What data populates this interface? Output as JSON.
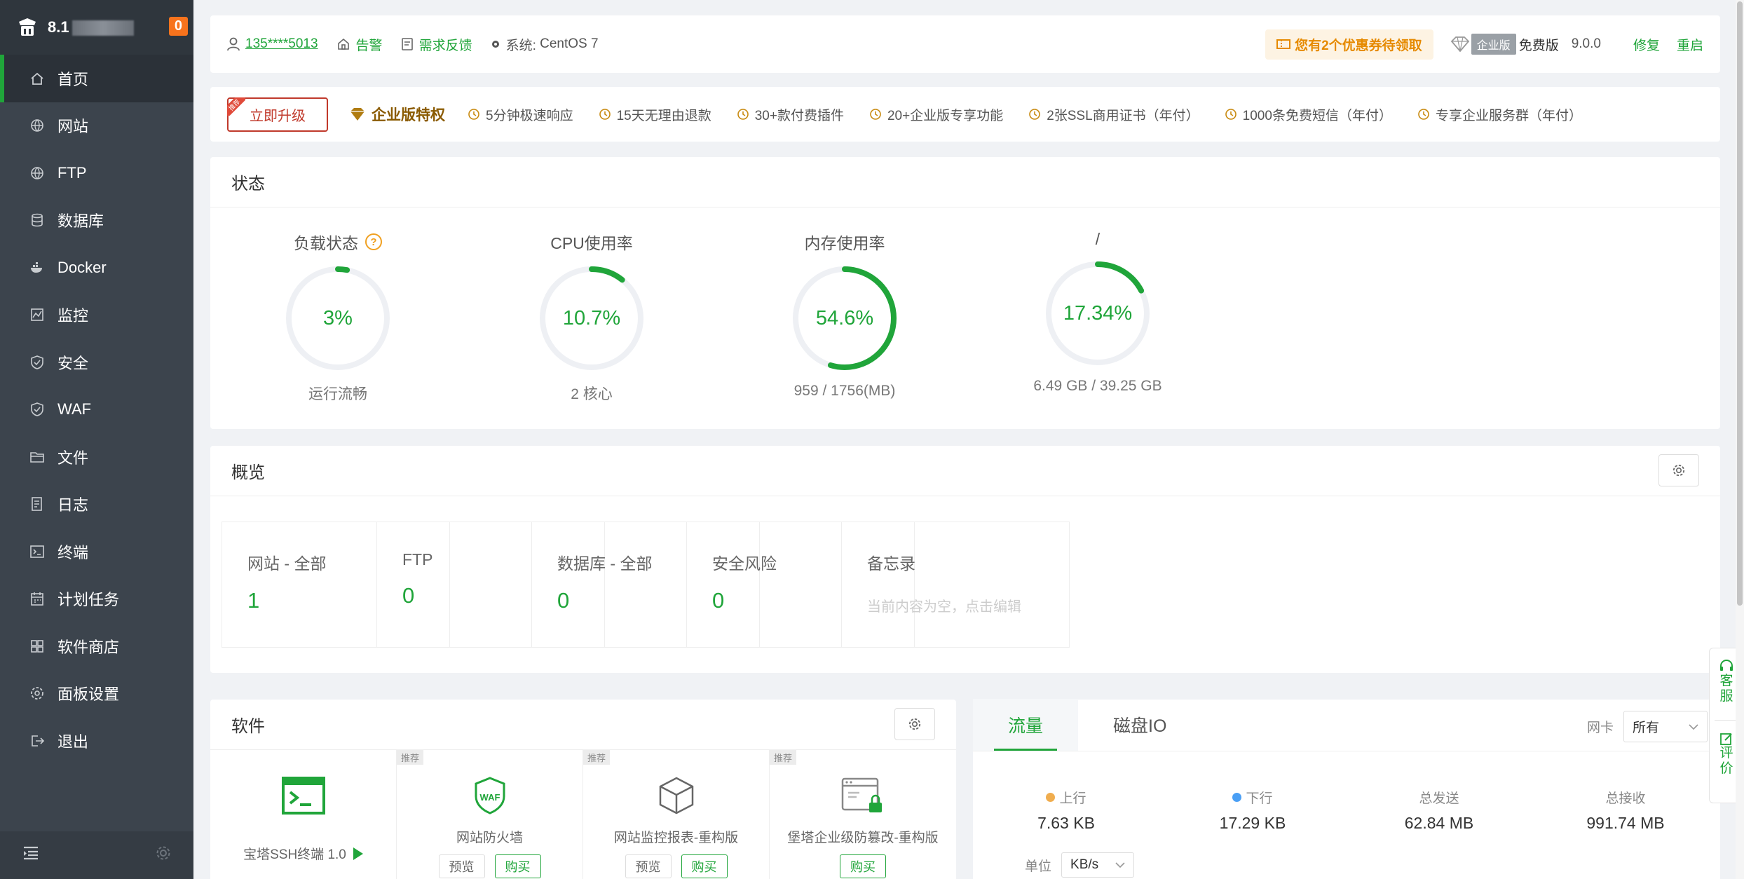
{
  "sidebar": {
    "ip_prefix": "8.1",
    "badge": "0",
    "items": [
      {
        "label": "首页",
        "icon": "home-icon"
      },
      {
        "label": "网站",
        "icon": "globe-icon"
      },
      {
        "label": "FTP",
        "icon": "globe-icon"
      },
      {
        "label": "数据库",
        "icon": "database-icon"
      },
      {
        "label": "Docker",
        "icon": "docker-icon"
      },
      {
        "label": "监控",
        "icon": "monitor-icon"
      },
      {
        "label": "安全",
        "icon": "shield-icon"
      },
      {
        "label": "WAF",
        "icon": "shield-icon"
      },
      {
        "label": "文件",
        "icon": "folder-icon"
      },
      {
        "label": "日志",
        "icon": "log-icon"
      },
      {
        "label": "终端",
        "icon": "terminal-icon"
      },
      {
        "label": "计划任务",
        "icon": "calendar-icon"
      },
      {
        "label": "软件商店",
        "icon": "grid-icon"
      },
      {
        "label": "面板设置",
        "icon": "gear-icon"
      },
      {
        "label": "退出",
        "icon": "logout-icon"
      }
    ]
  },
  "topbar": {
    "user": "135****5013",
    "alarm": "告警",
    "feedback": "需求反馈",
    "system_label": "系统:",
    "system_value": "CentOS 7",
    "coupon": "您有2个优惠券待领取",
    "enterprise_tag": "企业版",
    "edition": "免费版",
    "version": "9.0.0",
    "repair": "修复",
    "restart": "重启"
  },
  "upgrade": {
    "ribbon": "推荐",
    "button": "立即升级",
    "enterprise": "企业版特权",
    "features": [
      "5分钟极速响应",
      "15天无理由退款",
      "30+款付费插件",
      "20+企业版专享功能",
      "2张SSL商用证书（年付）",
      "1000条免费短信（年付）",
      "专享企业服务群（年付）"
    ]
  },
  "status": {
    "title": "状态",
    "gauges": [
      {
        "title": "负载状态",
        "value": "3%",
        "percent": 3,
        "sub": "运行流畅",
        "help": "?"
      },
      {
        "title": "CPU使用率",
        "value": "10.7%",
        "percent": 10.7,
        "sub": "2 核心"
      },
      {
        "title": "内存使用率",
        "value": "54.6%",
        "percent": 54.6,
        "sub": "959 / 1756(MB)"
      },
      {
        "title": "/",
        "value": "17.34%",
        "percent": 17.34,
        "sub": "6.49 GB / 39.25 GB"
      }
    ],
    "colors": {
      "ring": "#20a53a",
      "track": "#eef0f4"
    }
  },
  "overview": {
    "title": "概览",
    "boxes": [
      {
        "label": "网站 - 全部",
        "value": "1"
      },
      {
        "label": "FTP",
        "value": "0"
      },
      {
        "label": "数据库 - 全部",
        "value": "0"
      },
      {
        "label": "安全风险",
        "value": "0"
      },
      {
        "label": "备忘录",
        "note": "当前内容为空，点击编辑"
      }
    ]
  },
  "software": {
    "title": "软件",
    "items": [
      {
        "name": "宝塔SSH终端 1.0",
        "tag": ""
      },
      {
        "name": "网站防火墙",
        "tag": "推荐",
        "preview": "预览",
        "buy": "购买"
      },
      {
        "name": "网站监控报表-重构版",
        "tag": "推荐",
        "preview": "预览",
        "buy": "购买"
      },
      {
        "name": "堡塔企业级防篡改-重构版",
        "tag": "推荐",
        "buy": "购买"
      }
    ]
  },
  "traffic": {
    "tabs": [
      "流量",
      "磁盘IO"
    ],
    "nic_label": "网卡",
    "nic_value": "所有",
    "stats": [
      {
        "label": "上行",
        "value": "7.63 KB",
        "color": "#f0ad4e"
      },
      {
        "label": "下行",
        "value": "17.29 KB",
        "color": "#4a9ff5"
      },
      {
        "label": "总发送",
        "value": "62.84 MB"
      },
      {
        "label": "总接收",
        "value": "991.74 MB"
      }
    ],
    "unit_label": "单位",
    "unit_value": "KB/s"
  },
  "float": {
    "service": "客服",
    "review": "评价"
  },
  "accent": "#20a53a"
}
